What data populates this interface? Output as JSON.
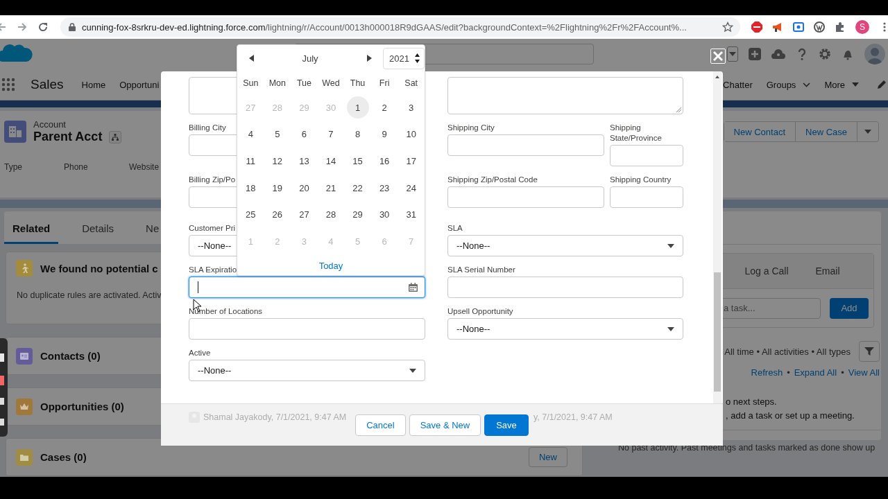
{
  "browser": {
    "url_host": "cunning-fox-8srkru-dev-ed.lightning.force.com",
    "url_path": "/lightning/r/Account/0013h000018R9dGAAS/edit?backgroundContext=%2Flightning%2Fr%2FAccount%...",
    "profile_initial": "S"
  },
  "header": {
    "app_name": "Sales",
    "nav": [
      {
        "label": "Home"
      },
      {
        "label": "Opportuni"
      }
    ],
    "nav_right": [
      {
        "label": "Chatter",
        "kind": "plain"
      },
      {
        "label": "Groups",
        "kind": "chevron"
      },
      {
        "label": "More",
        "kind": "caret"
      }
    ]
  },
  "record": {
    "object_label": "Account",
    "name": "Parent Acct",
    "fields": [
      "Type",
      "Phone",
      "Website"
    ],
    "actions": [
      "New Contact",
      "New Case"
    ]
  },
  "tabs": [
    {
      "label": "Related",
      "selected": true
    },
    {
      "label": "Details",
      "selected": false
    },
    {
      "label": "Ne",
      "selected": false
    }
  ],
  "cards": [
    {
      "kind": "notice",
      "title": "We found no potential c",
      "text": "No duplicate rules are activated. Activ",
      "color": "#a38c3b"
    },
    {
      "kind": "related",
      "title": "Contacts (0)",
      "color": "#645c9a"
    },
    {
      "kind": "related",
      "title": "Opportunities (0)",
      "color": "#a0783a"
    },
    {
      "kind": "related",
      "title": "Cases (0)",
      "color": "#a08c42",
      "action": "New"
    }
  ],
  "activity": {
    "tabs": [
      "Log a Call",
      "Email"
    ],
    "task_placeholder": "a task...",
    "add_button": "Add",
    "filters": "All time • All activities • All types",
    "links": [
      {
        "kind": "link",
        "text": "Refresh"
      },
      {
        "kind": "separator",
        "text": "•"
      },
      {
        "kind": "link",
        "text": "Expand All"
      },
      {
        "kind": "separator",
        "text": "•"
      },
      {
        "kind": "link",
        "text": "View All"
      }
    ],
    "next_steps": [
      "o next steps.",
      ", add a task or set up a meeting."
    ],
    "past": "No past activity. Past meetings and tasks marked as done show up"
  },
  "modal": {
    "rows": [
      {
        "left": {
          "kind": "textarea",
          "focused": false
        },
        "right": [
          {
            "kind": "textarea",
            "focused": false
          }
        ]
      },
      {
        "left": {
          "label": "Billing City",
          "kind": "text",
          "focused": false
        },
        "right": [
          {
            "label": "Shipping City",
            "kind": "text",
            "focused": false
          },
          {
            "label": "Shipping State/Province",
            "kind": "text",
            "focused": false
          }
        ]
      },
      {
        "left": {
          "label": "Billing Zip/Po",
          "kind": "text",
          "focused": false
        },
        "right": [
          {
            "label": "Shipping Zip/Postal Code",
            "kind": "text",
            "focused": false
          },
          {
            "label": "Shipping Country",
            "kind": "text",
            "focused": false
          }
        ]
      },
      {
        "left": {
          "label": "Customer Pri",
          "kind": "select",
          "value": "--None--",
          "focused": false
        },
        "right": [
          {
            "label": "SLA",
            "kind": "select",
            "value": "--None--",
            "focused": false
          }
        ]
      },
      {
        "left": {
          "label": "SLA Expiratio",
          "kind": "date",
          "focused": true
        },
        "right": [
          {
            "label": "SLA Serial Number",
            "kind": "text",
            "focused": false
          }
        ]
      },
      {
        "left": {
          "label": "Number of Locations",
          "kind": "text",
          "focused": false
        },
        "right": [
          {
            "label": "Upsell Opportunity",
            "kind": "select",
            "value": "--None--",
            "focused": false
          }
        ]
      },
      {
        "left": {
          "label": "Active",
          "kind": "select",
          "value": "--None--",
          "focused": false
        },
        "right": []
      }
    ],
    "created_by": "Shamal Jayakody, 7/1/2021, 9:47 AM",
    "modified_by": "y, 7/1/2021, 9:47 AM",
    "buttons": [
      {
        "label": "Cancel",
        "kind": "neutral"
      },
      {
        "label": "Save & New",
        "kind": "neutral"
      },
      {
        "label": "Save",
        "kind": "brand"
      }
    ]
  },
  "datepicker": {
    "month": "July",
    "year": "2021",
    "weekdays": [
      "Sun",
      "Mon",
      "Tue",
      "Wed",
      "Thu",
      "Fri",
      "Sat"
    ],
    "today_link": "Today",
    "weeks": [
      [
        {
          "day": "27",
          "in_month": false,
          "today": false,
          "selected": false
        },
        {
          "day": "28",
          "in_month": false,
          "today": false,
          "selected": false
        },
        {
          "day": "29",
          "in_month": false,
          "today": false,
          "selected": false
        },
        {
          "day": "30",
          "in_month": false,
          "today": false,
          "selected": false
        },
        {
          "day": "1",
          "in_month": true,
          "today": true,
          "selected": false
        },
        {
          "day": "2",
          "in_month": true,
          "today": false,
          "selected": false
        },
        {
          "day": "3",
          "in_month": true,
          "today": false,
          "selected": false
        }
      ],
      [
        {
          "day": "4",
          "in_month": true,
          "today": false,
          "selected": false
        },
        {
          "day": "5",
          "in_month": true,
          "today": false,
          "selected": false
        },
        {
          "day": "6",
          "in_month": true,
          "today": false,
          "selected": false
        },
        {
          "day": "7",
          "in_month": true,
          "today": false,
          "selected": false
        },
        {
          "day": "8",
          "in_month": true,
          "today": false,
          "selected": false
        },
        {
          "day": "9",
          "in_month": true,
          "today": false,
          "selected": false
        },
        {
          "day": "10",
          "in_month": true,
          "today": false,
          "selected": false
        }
      ],
      [
        {
          "day": "11",
          "in_month": true,
          "today": false,
          "selected": false
        },
        {
          "day": "12",
          "in_month": true,
          "today": false,
          "selected": false
        },
        {
          "day": "13",
          "in_month": true,
          "today": false,
          "selected": false
        },
        {
          "day": "14",
          "in_month": true,
          "today": false,
          "selected": false
        },
        {
          "day": "15",
          "in_month": true,
          "today": false,
          "selected": false
        },
        {
          "day": "16",
          "in_month": true,
          "today": false,
          "selected": false
        },
        {
          "day": "17",
          "in_month": true,
          "today": false,
          "selected": false
        }
      ],
      [
        {
          "day": "18",
          "in_month": true,
          "today": false,
          "selected": false
        },
        {
          "day": "19",
          "in_month": true,
          "today": false,
          "selected": false
        },
        {
          "day": "20",
          "in_month": true,
          "today": false,
          "selected": false
        },
        {
          "day": "21",
          "in_month": true,
          "today": false,
          "selected": false
        },
        {
          "day": "22",
          "in_month": true,
          "today": false,
          "selected": false
        },
        {
          "day": "23",
          "in_month": true,
          "today": false,
          "selected": false
        },
        {
          "day": "24",
          "in_month": true,
          "today": false,
          "selected": false
        }
      ],
      [
        {
          "day": "25",
          "in_month": true,
          "today": false,
          "selected": false
        },
        {
          "day": "26",
          "in_month": true,
          "today": false,
          "selected": false
        },
        {
          "day": "27",
          "in_month": true,
          "today": false,
          "selected": false
        },
        {
          "day": "28",
          "in_month": true,
          "today": false,
          "selected": false
        },
        {
          "day": "29",
          "in_month": true,
          "today": false,
          "selected": false
        },
        {
          "day": "30",
          "in_month": true,
          "today": false,
          "selected": false
        },
        {
          "day": "31",
          "in_month": true,
          "today": false,
          "selected": false
        }
      ],
      [
        {
          "day": "1",
          "in_month": false,
          "today": false,
          "selected": false
        },
        {
          "day": "2",
          "in_month": false,
          "today": false,
          "selected": false
        },
        {
          "day": "3",
          "in_month": false,
          "today": false,
          "selected": false
        },
        {
          "day": "4",
          "in_month": false,
          "today": false,
          "selected": false
        },
        {
          "day": "5",
          "in_month": false,
          "today": false,
          "selected": false
        },
        {
          "day": "6",
          "in_month": false,
          "today": false,
          "selected": false
        },
        {
          "day": "7",
          "in_month": false,
          "today": false,
          "selected": false
        }
      ]
    ]
  }
}
